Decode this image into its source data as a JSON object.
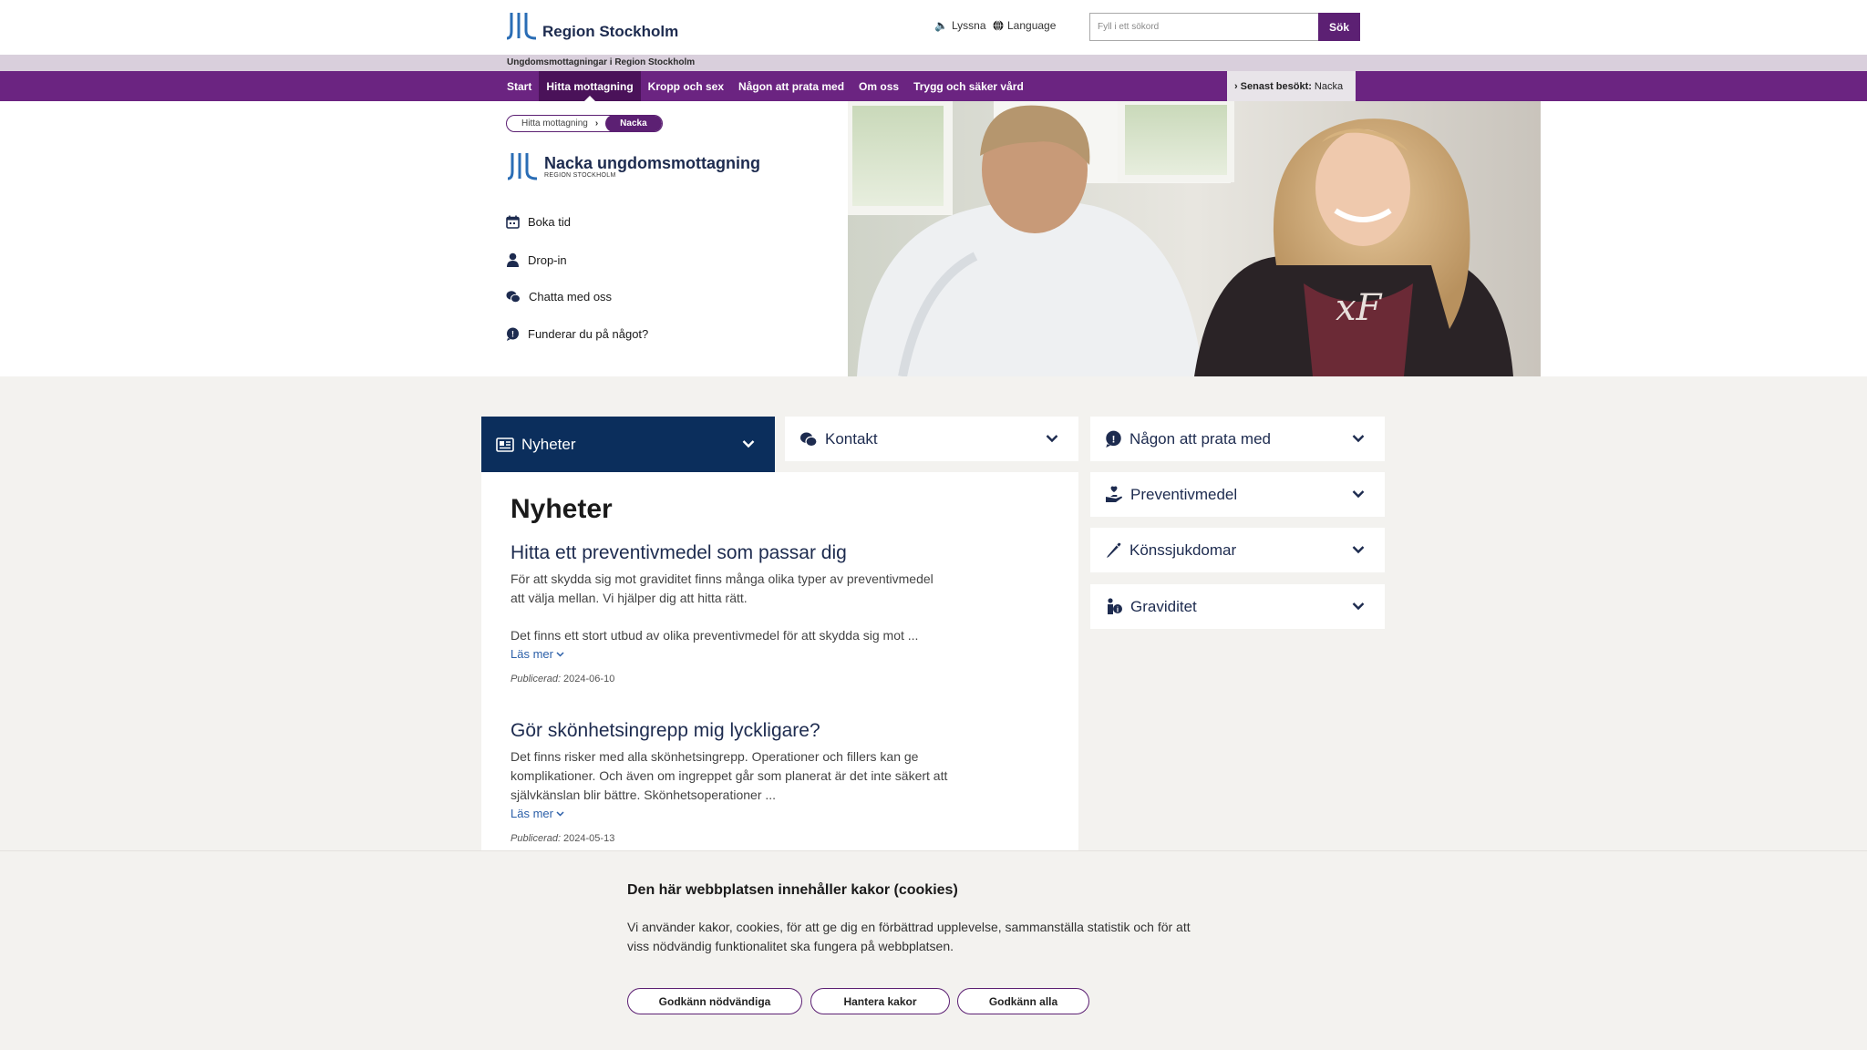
{
  "header": {
    "brand": "Region Stockholm",
    "listen_label": "Lyssna",
    "language_label": "Language",
    "search_placeholder": "Fyll i ett sökord",
    "search_button": "Sök",
    "site_name": "Ungdomsmottagningar i Region Stockholm"
  },
  "nav": {
    "items": [
      {
        "label": "Start"
      },
      {
        "label": "Hitta mottagning",
        "active": true
      },
      {
        "label": "Kropp och sex"
      },
      {
        "label": "Någon att prata med"
      },
      {
        "label": "Om oss"
      },
      {
        "label": "Trygg och säker vård"
      }
    ],
    "recent_prefix": "Senast besökt:",
    "recent_value": "Nacka"
  },
  "breadcrumb": {
    "parent": "Hitta mottagning",
    "current": "Nacka"
  },
  "clinic": {
    "name": "Nacka ungdomsmottagning",
    "sub": "REGION STOCKHOLM"
  },
  "quick_links": [
    {
      "label": "Boka tid",
      "icon": "calendar-icon"
    },
    {
      "label": "Drop-in",
      "icon": "person-icon"
    },
    {
      "label": "Chatta med oss",
      "icon": "chat-icon"
    },
    {
      "label": "Funderar du på något?",
      "icon": "question-bubble-icon"
    }
  ],
  "accordions": {
    "nyheter": "Nyheter",
    "kontakt": "Kontakt",
    "prata": "Någon att prata med",
    "preventiv": "Preventivmedel",
    "kons": "Könssjukdomar",
    "graviditet": "Graviditet"
  },
  "news": {
    "heading": "Nyheter",
    "articles": [
      {
        "title": "Hitta ett preventivmedel som passar dig",
        "p1": "För att skydda sig mot graviditet finns många olika typer av preventivmedel att välja mellan. Vi hjälper dig att hitta rätt.",
        "p2": "Det finns ett stort utbud av olika preventivmedel för att skydda sig mot ...",
        "more": "Läs mer",
        "date_label": "Publicerad:",
        "date": "2024-06-10"
      },
      {
        "title": "Gör skönhetsingrepp mig lyckligare?",
        "p1": "Det finns risker med alla skönhetsingrepp. Operationer och fillers kan ge komplikationer. Och även om ingreppet går som planerat är det inte säkert att självkänslan blir bättre. Skönhetsoperationer ...",
        "more": "Läs mer",
        "date_label": "Publicerad:",
        "date": "2024-05-13"
      }
    ]
  },
  "cookie": {
    "title": "Den här webbplatsen innehåller kakor (cookies)",
    "text": "Vi använder kakor, cookies, för att ge dig en förbättrad upplevelse, sammanställa statistik och för att viss nödvändig funktionalitet ska fungera på webbplatsen.",
    "btn_necessary": "Godkänn nödvändiga",
    "btn_manage": "Hantera kakor",
    "btn_all": "Godkänn alla"
  },
  "colors": {
    "purple": "#6b2481",
    "dark_purple": "#4a1259",
    "navy": "#0b2e5c",
    "brand_blue": "#1d2b4f"
  }
}
